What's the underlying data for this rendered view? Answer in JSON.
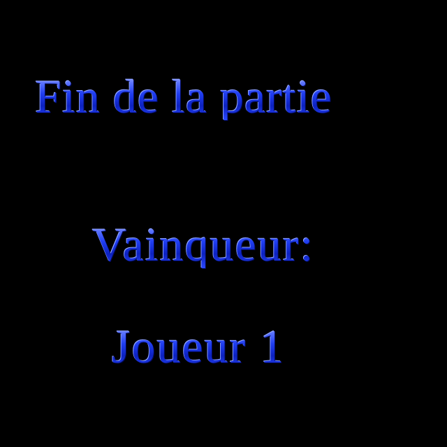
{
  "screen": {
    "title": "Fin de la partie",
    "winner_label": "Vainqueur:",
    "winner_name": "Joueur 1"
  },
  "colors": {
    "background": "#000000",
    "text_primary": "#1f3df0",
    "text_highlight": "#b8c4ff",
    "text_shadow": "#020a5a"
  }
}
